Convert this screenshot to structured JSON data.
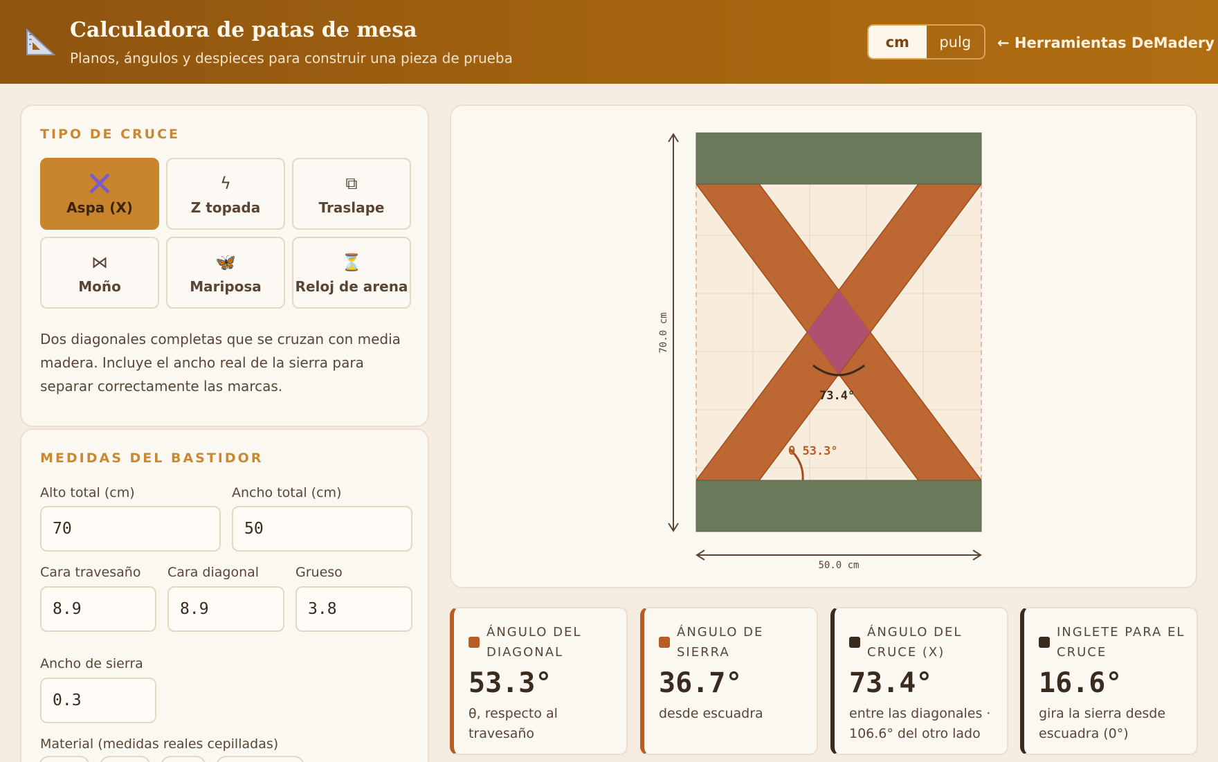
{
  "header": {
    "title": "Calculadora de patas de mesa",
    "subtitle": "Planos, ángulos y despieces para construir una pieza de prueba",
    "units": [
      "cm",
      "pulg"
    ],
    "active_unit": "cm",
    "back_link": "← Herramientas DeMadery"
  },
  "cross_type": {
    "section_title": "TIPO DE CRUCE",
    "options": [
      {
        "label": "Aspa (X)",
        "icon": "x-cross-icon",
        "active": true
      },
      {
        "label": "Z topada",
        "icon": "lightning-z-icon",
        "glyph": "ϟ"
      },
      {
        "label": "Traslape",
        "icon": "overlap-squares-icon",
        "glyph": "⧉"
      },
      {
        "label": "Moño",
        "icon": "bowtie-icon",
        "glyph": "⋈"
      },
      {
        "label": "Mariposa",
        "icon": "butterfly-icon",
        "glyph": "🦋"
      },
      {
        "label": "Reloj de arena",
        "icon": "hourglass-icon",
        "glyph": "⏳"
      }
    ],
    "description": "Dos diagonales completas que se cruzan con media madera. Incluye el ancho real de la sierra para separar correctamente las marcas."
  },
  "frame": {
    "section_title": "MEDIDAS DEL BASTIDOR",
    "height": {
      "label": "Alto total (cm)",
      "value": "70"
    },
    "width": {
      "label": "Ancho total (cm)",
      "value": "50"
    },
    "rail_face": {
      "label": "Cara travesaño",
      "value": "8.9"
    },
    "diagonal_face": {
      "label": "Cara diagonal",
      "value": "8.9"
    },
    "thickness": {
      "label": "Grueso",
      "value": "3.8"
    },
    "saw_kerf": {
      "label": "Ancho de sierra",
      "value": "0.3"
    },
    "material_label": "Material (medidas reales cepilladas)"
  },
  "drawing": {
    "height_label": "70.0 cm",
    "width_label": "50.0 cm",
    "cross_angle_label": "73.4°",
    "diagonal_angle_label": "θ 53.3°",
    "colors": {
      "rail": "#6a7a5a",
      "diagonal": "#b85c26",
      "joint": "#b04f72",
      "grid": "#eadcca"
    }
  },
  "results": [
    {
      "title": "ÁNGULO DEL DIAGONAL",
      "value": "53.3°",
      "sub": "θ, respecto al travesaño",
      "accent": "#b85c26"
    },
    {
      "title": "ÁNGULO DE SIERRA",
      "value": "36.7°",
      "sub": "desde escuadra",
      "accent": "#b85c26"
    },
    {
      "title": "ÁNGULO DEL CRUCE (X)",
      "value": "73.4°",
      "sub": "entre las diagonales · 106.6° del otro lado",
      "accent": "#3b2a1e"
    },
    {
      "title": "INGLETE PARA EL CRUCE",
      "value": "16.6°",
      "sub": "gira la sierra desde escuadra (0°)",
      "accent": "#3b2a1e"
    }
  ]
}
